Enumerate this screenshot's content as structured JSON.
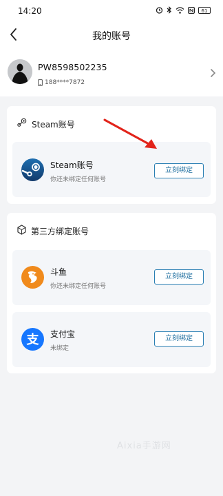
{
  "status_bar": {
    "time": "14:20",
    "battery": "61",
    "icons": [
      "alarm-icon",
      "bluetooth-icon",
      "wifi-icon",
      "nfc-icon",
      "battery-icon"
    ]
  },
  "nav": {
    "title": "我的账号",
    "back_icon": "back-arrow-icon"
  },
  "profile": {
    "username": "PW8598502235",
    "phone": "188****7872",
    "phone_icon": "phone-icon",
    "chevron_icon": "chevron-right-icon"
  },
  "steam_section": {
    "title": "Steam账号",
    "icon": "steam-outline-icon",
    "account": {
      "name": "Steam账号",
      "status": "你还未绑定任何账号",
      "button": "立刻绑定",
      "icon": "steam-logo-icon"
    }
  },
  "third_party_section": {
    "title": "第三方绑定账号",
    "icon": "hexagon-icon",
    "accounts": [
      {
        "name": "斗鱼",
        "status": "你还未绑定任何账号",
        "button": "立刻绑定",
        "icon": "douyu-logo-icon",
        "color": "#f08a1c"
      },
      {
        "name": "支付宝",
        "status": "未绑定",
        "button": "立刻绑定",
        "icon": "alipay-logo-icon",
        "color": "#1677ff"
      }
    ]
  },
  "colors": {
    "accent": "#1e6e9f",
    "arrow": "#e2231a",
    "steam": "#1b4f8a"
  },
  "watermark": "Aixia手游网"
}
